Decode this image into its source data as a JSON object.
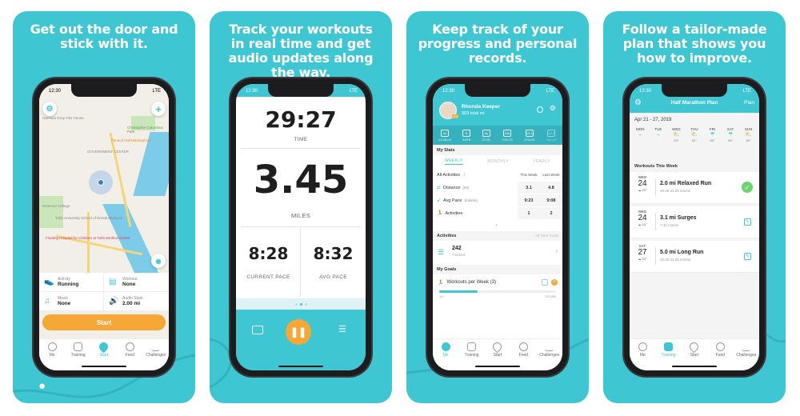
{
  "colors": {
    "brand": "#3ec6d3",
    "accent": "#f5a836",
    "success": "#6dd36f",
    "text": "#222222"
  },
  "panels": [
    {
      "headline": "Get out the door and stick with it.",
      "status_time": "12:30",
      "status_right": "LTE",
      "map": {
        "labels": [
          "Harrison Gray Otis House",
          "Christopher Columbus Park",
          "Faneuil Hall Marketplace",
          "GOVERNMENT CENTER",
          "Emerson College",
          "Tufts University School of Dental Medicine",
          "Floating Hospital for Children at Tufts Medical Center"
        ],
        "settings_icon": "gear-icon",
        "add_icon": "plus-icon",
        "audio_icon": "broadcast-icon"
      },
      "setup": [
        {
          "icon": "shoe-icon",
          "label": "Activity",
          "value": "Running"
        },
        {
          "icon": "clipboard-icon",
          "label": "Workout",
          "value": "None"
        },
        {
          "icon": "music-icon",
          "label": "Music",
          "value": "None"
        },
        {
          "icon": "speaker-icon",
          "label": "Audio Stats",
          "value": "2.00 mi"
        }
      ],
      "start_label": "Start",
      "tabs": [
        "Me",
        "Training",
        "Start",
        "Feed",
        "Challenges"
      ],
      "active_tab": "Start"
    },
    {
      "headline": "Track your workouts in real time and get audio updates along the way.",
      "status_time": "12:30",
      "status_right": "LTE",
      "time_value": "29:27",
      "time_label": "TIME",
      "distance_value": "3.45",
      "distance_label": "MILES",
      "current_pace_value": "8:28",
      "current_pace_label": "CURRENT PACE",
      "avg_pace_value": "8:32",
      "avg_pace_label": "AVG PACE",
      "page_dots": 3,
      "active_dot": 2
    },
    {
      "headline": "Keep track of your progress and personal records.",
      "status_time": "12:30",
      "status_right": "LTE",
      "user_name": "Rhonda Keeper",
      "user_total": "903 total mi",
      "avatar_badge": "GO",
      "records": [
        "13.28 mi",
        "648 ft",
        "27:05",
        "1:01:13",
        "2:04:24",
        "Not yet"
      ],
      "record_badges": [
        "mi",
        "ft",
        "5k",
        "10k",
        "13.1",
        "26.2"
      ],
      "my_stats_title": "My Stats",
      "stat_tabs": [
        "WEEKLY",
        "MONTHLY",
        "YEARLY"
      ],
      "active_stat_tab": "WEEKLY",
      "filter_label": "All Activities",
      "col_this_week": "This Week",
      "col_last_week": "Last Week",
      "stats": [
        {
          "label": "Distance",
          "unit": "(mi)",
          "this_week": "3.1",
          "last_week": "4.8"
        },
        {
          "label": "Avg Pace",
          "unit": "(min/mi)",
          "this_week": "9:23",
          "last_week": "9:08"
        },
        {
          "label": "Activities",
          "unit": "",
          "this_week": "1",
          "last_week": "2"
        }
      ],
      "activities_title": "Activities",
      "activities_right": "All Time Totals",
      "activities_count": "242",
      "activities_sub": "Tracked",
      "goals_title": "My Goals",
      "goal_label": "Workouts per Week (3)",
      "goal_progress": 0.33,
      "goal_left": "1/3",
      "goal_right": "33.33%",
      "tabs": [
        "Me",
        "Training",
        "Start",
        "Feed",
        "Challenges"
      ],
      "active_tab": "Me"
    },
    {
      "headline": "Follow a tailor-made plan that shows you how to improve.",
      "status_time": "12:30",
      "status_right": "LTE",
      "plan_title": "Half Marathon Plan",
      "plan_link": "Plan",
      "date_range": "Apr 21 - 27, 2019",
      "days": [
        {
          "day": "MON",
          "weather": "",
          "temp": ""
        },
        {
          "day": "TUE",
          "weather": "",
          "temp": ""
        },
        {
          "day": "WED",
          "weather": "partly-cloudy",
          "temp": "63°"
        },
        {
          "day": "THU",
          "weather": "partly-cloudy",
          "temp": "62°"
        },
        {
          "day": "FRI",
          "weather": "rain",
          "temp": "55°"
        },
        {
          "day": "SAT",
          "weather": "rain",
          "temp": "59°"
        },
        {
          "day": "SUN",
          "weather": "partly-cloudy",
          "temp": "62°"
        }
      ],
      "workouts_title": "Workouts This Week",
      "workouts": [
        {
          "dow": "WED",
          "date": "24",
          "temp": "63°",
          "title": "2.0 mi Relaxed Run",
          "pace": "10:25-11:25 min/mi",
          "status": "done"
        },
        {
          "dow": "WED",
          "date": "24",
          "temp": "63°",
          "title": "3.1 mi Surges",
          "pace": "7:40 min/mi",
          "status": "edit"
        },
        {
          "dow": "SAT",
          "date": "27",
          "temp": "59°",
          "title": "5.0 mi Long Run",
          "pace": "10:25-11:25 min/mi",
          "status": "edit"
        }
      ],
      "tabs": [
        "Me",
        "Training",
        "Start",
        "Feed",
        "Challenges"
      ],
      "active_tab": "Training"
    }
  ]
}
